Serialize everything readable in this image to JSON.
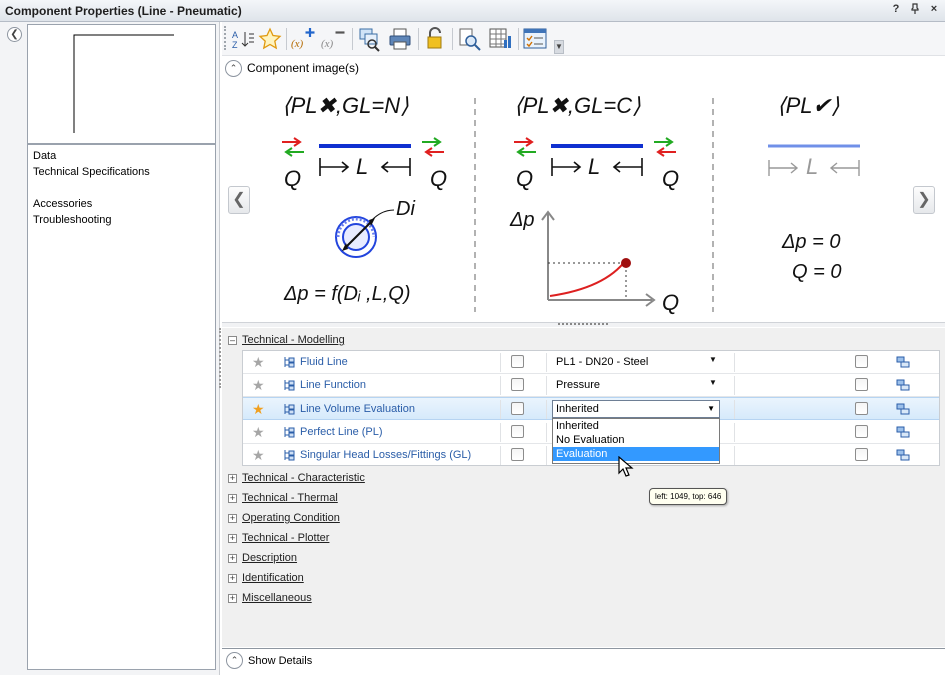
{
  "window": {
    "title": "Component Properties (Line - Pneumatic)",
    "controls": [
      "?",
      "↔",
      "×"
    ]
  },
  "left_panel": {
    "items": [
      "Data",
      "Technical Specifications",
      "Accessories",
      "Troubleshooting"
    ]
  },
  "toolbar": {
    "icons": [
      "sort-az-icon",
      "favorite-star-icon",
      "add-variable-icon",
      "remove-variable-icon",
      "find-replace-icon",
      "print-icon",
      "unlock-icon",
      "user-search-icon",
      "table-icon",
      "checklist-icon"
    ]
  },
  "images_section": {
    "label": "Component image(s)",
    "panels": [
      {
        "formula": "⟨PL✖,GL=N⟩",
        "flow_left": "Q",
        "length": "L",
        "flow_right": "Q",
        "diameter": "Di",
        "pressure_drop": "Δp = f(Dᵢ ,L,Q)"
      },
      {
        "formula": "⟨PL✖,GL=C⟩",
        "flow_left": "Q",
        "length": "L",
        "flow_right": "Q",
        "y_axis": "Δp",
        "x_axis": "Q"
      },
      {
        "formula": "⟨PL✔⟩",
        "length": "L",
        "dp": "Δp = 0",
        "q": "Q = 0"
      }
    ]
  },
  "property_grid": {
    "expanded_category": "Technical - Modelling",
    "rows": [
      {
        "name": "Fluid Line",
        "value": "PL1 - DN20 - Steel",
        "favorite": false,
        "has_dropdown": true
      },
      {
        "name": "Line Function",
        "value": "Pressure",
        "favorite": false,
        "has_dropdown": true
      },
      {
        "name": "Line Volume Evaluation",
        "value": "Inherited",
        "favorite": true,
        "has_dropdown": true,
        "selected": true
      },
      {
        "name": "Perfect Line (PL)",
        "value": "",
        "favorite": false,
        "has_dropdown": false
      },
      {
        "name": "Singular Head Losses/Fittings (GL)",
        "value": "",
        "favorite": false,
        "has_dropdown": false
      }
    ],
    "dropdown_options": [
      "Inherited",
      "No Evaluation",
      "Evaluation"
    ],
    "highlighted_option": "Evaluation",
    "collapsed_categories": [
      "Technical - Characteristic",
      "Technical - Thermal",
      "Operating Condition",
      "Technical - Plotter",
      "Description",
      "Identification",
      "Miscellaneous"
    ]
  },
  "tooltip": "left: 1049, top: 646",
  "bottom": {
    "label": "Show Details"
  },
  "colors": {
    "accent_blue": "#2a5da8",
    "selection": "#3399ff",
    "red": "#e02020",
    "green": "#22aa22"
  }
}
